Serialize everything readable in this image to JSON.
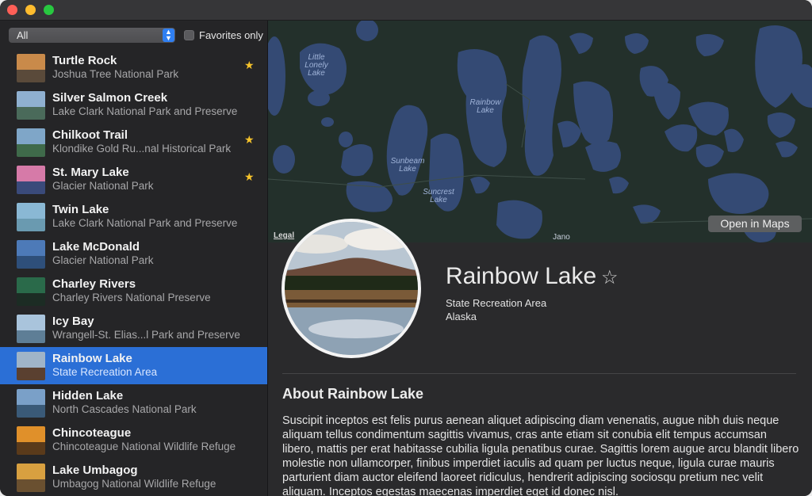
{
  "filter": {
    "selected": "All",
    "favorites_label": "Favorites only"
  },
  "landmarks": [
    {
      "name": "Turtle Rock",
      "park": "Joshua Tree National Park",
      "favorite": true,
      "sky": "#c98a4a",
      "land": "#5a4a3a"
    },
    {
      "name": "Silver Salmon Creek",
      "park": "Lake Clark National Park and Preserve",
      "favorite": false,
      "sky": "#8fb0d0",
      "land": "#4a6a5a"
    },
    {
      "name": "Chilkoot Trail",
      "park": "Klondike Gold Ru...nal Historical Park",
      "favorite": true,
      "sky": "#7fa6c8",
      "land": "#3f6a4a"
    },
    {
      "name": "St. Mary Lake",
      "park": "Glacier National Park",
      "favorite": true,
      "sky": "#d67aa8",
      "land": "#3a4a7a"
    },
    {
      "name": "Twin Lake",
      "park": "Lake Clark National Park and Preserve",
      "favorite": false,
      "sky": "#8ab8d4",
      "land": "#6a9ab0"
    },
    {
      "name": "Lake McDonald",
      "park": "Glacier National Park",
      "favorite": false,
      "sky": "#4d7ab8",
      "land": "#2e4f7a"
    },
    {
      "name": "Charley Rivers",
      "park": "Charley Rivers National Preserve",
      "favorite": false,
      "sky": "#2a6a4a",
      "land": "#1c2c24"
    },
    {
      "name": "Icy Bay",
      "park": "Wrangell-St. Elias...l Park and Preserve",
      "favorite": false,
      "sky": "#a9c4dc",
      "land": "#5e7e96"
    },
    {
      "name": "Rainbow Lake",
      "park": "State Recreation Area",
      "favorite": false,
      "sky": "#9fb4c8",
      "land": "#5a4030"
    },
    {
      "name": "Hidden Lake",
      "park": "North Cascades National Park",
      "favorite": false,
      "sky": "#7aa0c8",
      "land": "#3a5a78"
    },
    {
      "name": "Chincoteague",
      "park": "Chincoteague National Wildlife Refuge",
      "favorite": false,
      "sky": "#e0902a",
      "land": "#5a3a1a"
    },
    {
      "name": "Lake Umbagog",
      "park": "Umbagog National Wildlife Refuge",
      "favorite": false,
      "sky": "#d8a040",
      "land": "#6a5030"
    }
  ],
  "selected_index": 8,
  "map": {
    "labels": [
      "Little Lonely Lake",
      "Rainbow Lake",
      "Sunbeam Lake",
      "Suncrest Lake",
      "Jano"
    ],
    "legal": "Legal",
    "open_button": "Open in Maps"
  },
  "detail": {
    "name": "Rainbow Lake",
    "favorite_icon": "star-outline-icon",
    "type": "State Recreation Area",
    "state": "Alaska",
    "about_title": "About Rainbow Lake",
    "description": "Suscipit inceptos est felis purus aenean aliquet adipiscing diam venenatis, augue nibh duis neque aliquam tellus condimentum sagittis vivamus, cras ante etiam sit conubia elit tempus accumsan libero, mattis per erat habitasse cubilia ligula penatibus curae. Sagittis lorem augue arcu blandit libero molestie non ullamcorper, finibus imperdiet iaculis ad quam per luctus neque, ligula curae mauris parturient diam auctor eleifend laoreet ridiculus, hendrerit adipiscing sociosqu pretium nec velit aliquam. Inceptos egestas maecenas imperdiet eget id donec nisl."
  },
  "colors": {
    "accent": "#2b6fd6",
    "star": "#f6c32b",
    "water": "#344a74",
    "land": "#23302b"
  }
}
